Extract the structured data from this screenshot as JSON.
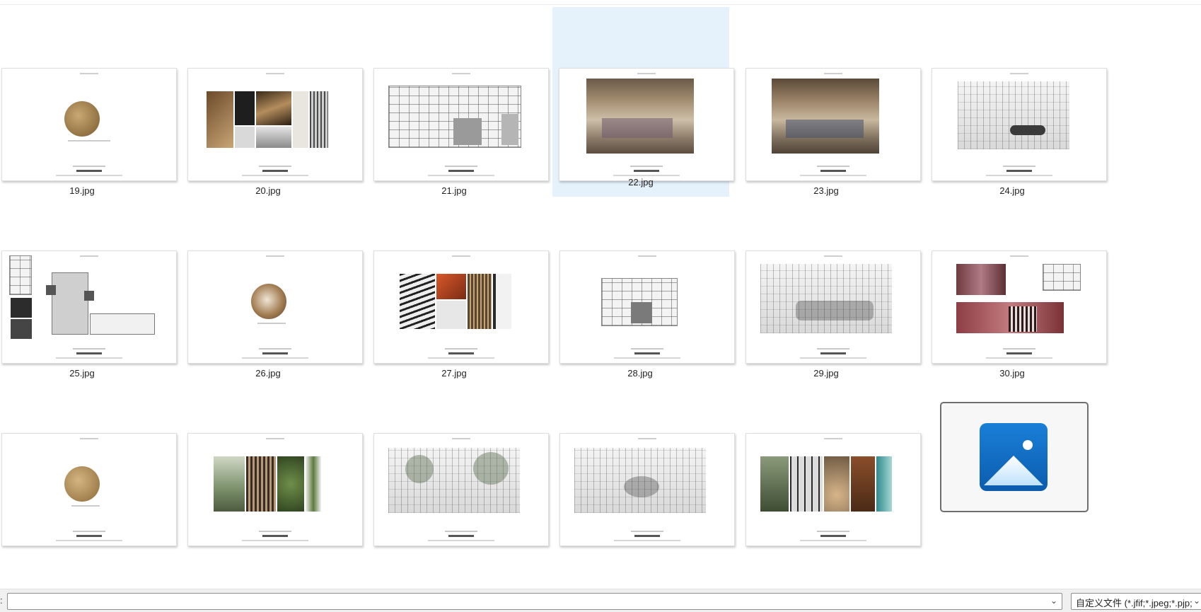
{
  "files": [
    {
      "name": "19.jpg",
      "thumb": "circle-gold"
    },
    {
      "name": "20.jpg",
      "thumb": "collage-dark"
    },
    {
      "name": "21.jpg",
      "thumb": "floor-plan"
    },
    {
      "name": "22.jpg",
      "thumb": "render-interior",
      "selected": true
    },
    {
      "name": "23.jpg",
      "thumb": "render-interior"
    },
    {
      "name": "24.jpg",
      "thumb": "sketch"
    },
    {
      "name": "25.jpg",
      "thumb": "elevation-plan"
    },
    {
      "name": "26.jpg",
      "thumb": "circle-brown"
    },
    {
      "name": "27.jpg",
      "thumb": "collage-mixed"
    },
    {
      "name": "28.jpg",
      "thumb": "floor-plan-small"
    },
    {
      "name": "29.jpg",
      "thumb": "sketch"
    },
    {
      "name": "30.jpg",
      "thumb": "elevation-red"
    },
    {
      "name": "",
      "thumb": "circle-gold"
    },
    {
      "name": "",
      "thumb": "collage-green"
    },
    {
      "name": "",
      "thumb": "sketch-trees"
    },
    {
      "name": "",
      "thumb": "sketch-dining"
    },
    {
      "name": "",
      "thumb": "collage-wood"
    },
    {
      "name": "",
      "thumb": "photos-app-icon"
    }
  ],
  "file_name_input": {
    "value": ""
  },
  "file_type_filter": {
    "selected": "自定义文件 (*.jfif;*.jpeg;*.pjp;*"
  },
  "colors": {
    "selection": "#e5f1fb",
    "photos_icon_blue": "#0f6cbd"
  }
}
